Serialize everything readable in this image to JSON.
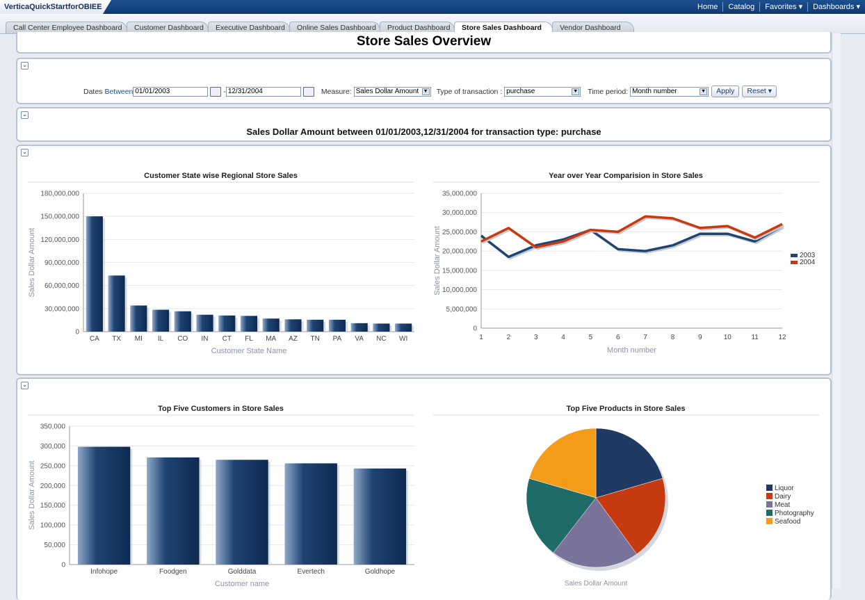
{
  "app": {
    "title": "VerticaQuickStartforOBIEE"
  },
  "topnav": [
    "Home",
    "Catalog",
    "Favorites ▾",
    "Dashboards ▾"
  ],
  "tabs": [
    "Call Center Employee Dashboard",
    "Customer Dashboard",
    "Executive Dashboard",
    "Online Sales Dashboard",
    "Product Dashboard",
    "Store Sales Dashboard",
    "Vendor Dashboard"
  ],
  "active_tab": "Store Sales Dashboard",
  "page_title": "Store Sales Overview",
  "prompts": {
    "dates_label": "Dates",
    "between_label": "Between",
    "start_date": "01/01/2003",
    "dash": "-",
    "end_date": "12/31/2004",
    "measure_label": "Measure:",
    "measure_value": "Sales Dollar Amount",
    "txn_label": "Type of transaction :",
    "txn_value": "purchase",
    "period_label": "Time period:",
    "period_value": "Month number",
    "apply": "Apply",
    "reset": "Reset ▾"
  },
  "subtitle": "Sales Dollar Amount between 01/01/2003,12/31/2004 for transaction type: purchase",
  "chart_data": [
    {
      "type": "bar",
      "title": "Customer State wise Regional Store Sales",
      "xlabel": "Customer State Name",
      "ylabel": "Sales Dollar Amount",
      "ylim": [
        0,
        180000000
      ],
      "yticks": [
        "0",
        "30,000,000",
        "60,000,000",
        "90,000,000",
        "120,000,000",
        "150,000,000",
        "180,000,000"
      ],
      "categories": [
        "CA",
        "TX",
        "MI",
        "IL",
        "CO",
        "IN",
        "CT",
        "FL",
        "MA",
        "AZ",
        "TN",
        "PA",
        "VA",
        "NC",
        "WI"
      ],
      "values": [
        150000000,
        73000000,
        34000000,
        28500000,
        26500000,
        22000000,
        21000000,
        20500000,
        17000000,
        16000000,
        15500000,
        15500000,
        11000000,
        10500000,
        10500000
      ],
      "color": "#1f4472"
    },
    {
      "type": "line",
      "title": "Year over Year Comparision in Store Sales",
      "xlabel": "Month number",
      "ylabel": "Sales Dollar Amount",
      "ylim": [
        0,
        35000000
      ],
      "yticks": [
        "0",
        "5,000,000",
        "10,000,000",
        "15,000,000",
        "20,000,000",
        "25,000,000",
        "30,000,000",
        "35,000,000"
      ],
      "x": [
        1,
        2,
        3,
        4,
        5,
        6,
        7,
        8,
        9,
        10,
        11,
        12
      ],
      "series": [
        {
          "name": "2003",
          "color": "#1f4472",
          "values": [
            24000000,
            18500000,
            21500000,
            23000000,
            25500000,
            20500000,
            20000000,
            21500000,
            24500000,
            24500000,
            22500000,
            26500000
          ]
        },
        {
          "name": "2004",
          "color": "#c63a12",
          "values": [
            22500000,
            26000000,
            21000000,
            22500000,
            25500000,
            25000000,
            29000000,
            28500000,
            26000000,
            26500000,
            23500000,
            27000000
          ]
        }
      ],
      "legend": "right"
    },
    {
      "type": "bar",
      "title": "Top Five Customers in Store Sales",
      "xlabel": "Customer name",
      "ylabel": "Sales Dollar Amount",
      "ylim": [
        0,
        350000
      ],
      "yticks": [
        "0",
        "50,000",
        "100,000",
        "150,000",
        "200,000",
        "250,000",
        "300,000",
        "350,000"
      ],
      "categories": [
        "Infohope",
        "Foodgen",
        "Golddata",
        "Evertech",
        "Goldhope"
      ],
      "values": [
        298000,
        271000,
        265000,
        256000,
        243000
      ],
      "color": "#1f4472"
    },
    {
      "type": "pie",
      "title": "Top Five Products in Store Sales",
      "xlabel": "Sales Dollar Amount",
      "categories": [
        "Liquor",
        "Dairy",
        "Meat",
        "Photography",
        "Seafood"
      ],
      "values": [
        20.5,
        19.5,
        20.5,
        19,
        20.5
      ],
      "colors": [
        "#1f3b63",
        "#c63a12",
        "#79739b",
        "#1f6b68",
        "#f59b1a"
      ],
      "legend": "right"
    }
  ]
}
